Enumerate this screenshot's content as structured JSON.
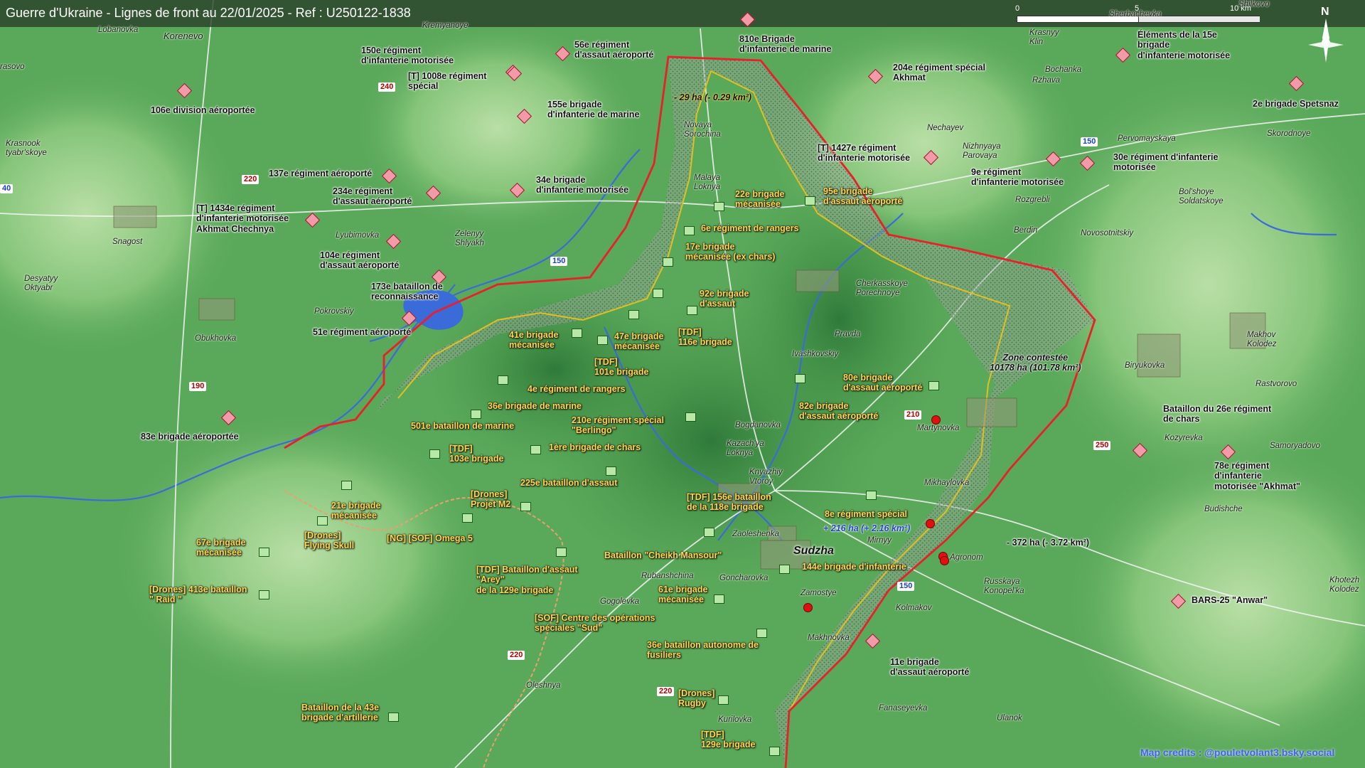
{
  "title": "Guerre d'Ukraine - Lignes de front au 22/01/2025 - Ref : U250122-1838",
  "colors": {
    "russian_fill": "#f19aa8",
    "ukrainian_fill": "#b8e8a8",
    "front_line": "#e8202a",
    "contested_line": "#e0c020",
    "terrain": "#5fae5f"
  },
  "scale": {
    "label_start": "0",
    "label_mid": "5",
    "label_end": "10 km"
  },
  "north_label": "N",
  "credits": "Map credits : @pouletvolant3.bsky.social",
  "zone": {
    "label": "Zone contestée\n10178 ha (101.78 km²)"
  },
  "changes": {
    "loss_north": "- 29 ha (- 0.29 km²)",
    "gain_sudzha": "+ 216 ha (+ 2.16 km²)",
    "loss_east": "- 372 ha (- 3.72 km²)"
  },
  "city": "Sudzha",
  "roads": [
    "240",
    "220",
    "150",
    "190",
    "210",
    "250",
    "150",
    "150",
    "220",
    "220",
    "40"
  ],
  "places": [
    "Lobanovka",
    "Korenevo",
    "rasovo",
    "Kremyanoye",
    "Krasnook\ntyabr'skoye",
    "Snagost",
    "Desyatyy\nOktyabr",
    "Pokrovskiy",
    "Obukhovka",
    "Lyubimovka",
    "Zelenyy\nShlyakh",
    "Novaya\nSorochina",
    "Malaya\nLoknya",
    "Nechayev",
    "Nizhnyaya\nParovaya",
    "Rozgrebli",
    "Berdin",
    "Novosotnitskiy",
    "Bol'shoye\nSoldatskoye",
    "Pervomayskaya",
    "Skorodnoye",
    "Krasnyy\nKlin",
    "Bochanka",
    "Rzhava",
    "Sherbachevka",
    "Shilkovo",
    "Cherkasskoye\nPorechnoye",
    "Pravda",
    "Ivashkovskiy",
    "Martynovka",
    "Mikhaylovka",
    "Bogdanovka",
    "Kazach'ya\nLoknya",
    "Knyazhiy\nVtoroy",
    "Zaoleshenka",
    "Mirnyy",
    "Agronom",
    "Rubanshchina",
    "Goncharovka",
    "Gogolevka",
    "Zamostye",
    "Kolmakov",
    "Russkaya\nKonopel'ka",
    "Makhnovka",
    "Oleshnya",
    "Kurilovka",
    "Fanaseyevka",
    "Ulanok",
    "Biryukovka",
    "Makhov\nKolodez",
    "Rastvorovo",
    "Kozyrevka",
    "Samoryadovo",
    "Budishche",
    "Khotezh\nKolodez"
  ],
  "russian_units": [
    "106e division aéroportée",
    "150e régiment\nd'infanterie motorisée",
    "56e régiment\nd'assaut aéroporté",
    "[T] 1008e régiment\nspécial",
    "155e brigade\nd'infanterie de marine",
    "810e Brigade\nd'infanterie de marine",
    "204e régiment spécial\nAkhmat",
    "Éléments de la 15e\nbrigade\nd'infanterie motorisée",
    "2e brigade Spetsnaz",
    "137e régiment aéroporté",
    "234e régiment\nd'assaut aéroporté",
    "34e brigade\nd'infanterie motorisée",
    "[T] 1434e régiment\nd'infanterie motorisée\nAkhmat Chechnya",
    "104e régiment\nd'assaut aéroporté",
    "173e bataillon de\nreconnaissance",
    "51e régiment aéroporté",
    "83e brigade aéroportée",
    "[T] 1427e régiment\nd'infanterie motorisée",
    "9e régiment\nd'infanterie motorisée",
    "30e régiment d'infanterie\nmotorisée",
    "Bataillon du 26e régiment\nde chars",
    "78e régiment\nd'infanterie\nmotorisée \"Akhmat\"",
    "BARS-25 \"Anwar\"",
    "11e brigade\nd'assaut aéroporté"
  ],
  "ukrainian_units": [
    "22e brigade\nmécanisée",
    "95e brigade\nd'assaut aéroporté",
    "6e régiment de rangers",
    "17e brigade\nmécanisée (ex chars)",
    "92e brigade\nd'assaut",
    "41e brigade\nmécanisée",
    "47e brigade\nmécanisée",
    "[TDF]\n116e brigade",
    "[TDF]\n101e brigade",
    "4e régiment de rangers",
    "36e brigade de marine",
    "501e bataillon de marine",
    "210e régiment spécial\n\"Berlingo\"",
    "[TDF]\n103e brigade",
    "1ère brigade de chars",
    "225e bataillon d'assaut",
    "[Drones]\nProjet M2",
    "21e brigade\nmécanisée",
    "[Drones]\nFlying Skull",
    "[NG] [SOF] Omega 5",
    "67e brigade\nmécanisée",
    "[Drones] 413e bataillon\n\" Raid \"",
    "[TDF] Bataillon d'assaut\n\"Arey\"\nde la 129e brigade",
    "Bataillon \"Cheikh Mansour\"",
    "[TDF] 156e bataillon\nde la 118e brigade",
    "8e régiment spécial",
    "144e brigade d'infanterie",
    "61e brigade\nmécanisée",
    "[SOF] Centre des opérations\nspéciales \"Sud\"",
    "36e bataillon autonome de\nfusiliers",
    "[Drones]\nRugby",
    "Bataillon de la 43e\nbrigade d'artillerie",
    "[TDF]\n129e brigade",
    "80e brigade\nd'assaut aéroporté",
    "82e brigade\nd'assaut aéroporté"
  ]
}
